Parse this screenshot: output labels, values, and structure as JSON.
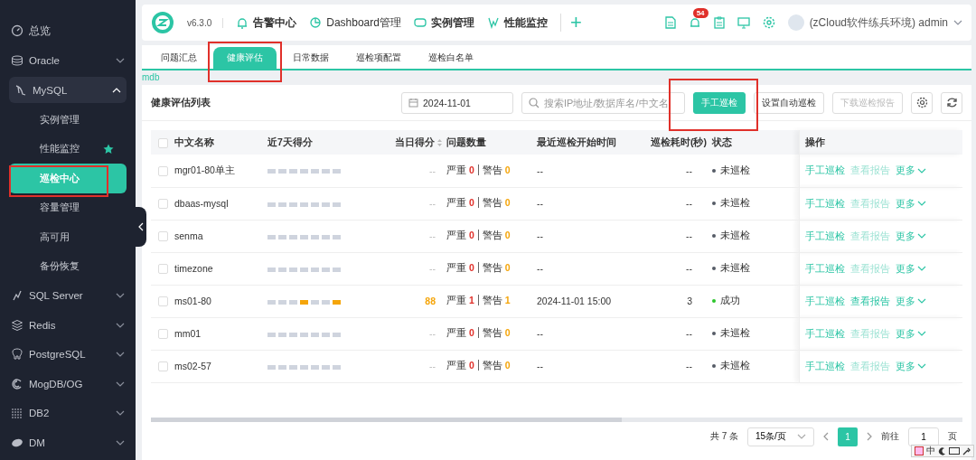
{
  "sidebar": {
    "items": [
      {
        "label": "总览"
      },
      {
        "label": "Oracle",
        "expanded": false
      },
      {
        "label": "MySQL",
        "expanded": true,
        "children": [
          {
            "label": "实例管理",
            "selected": false,
            "starred": false,
            "highlighted": false
          },
          {
            "label": "性能监控",
            "selected": false,
            "starred": true,
            "highlighted": false
          },
          {
            "label": "巡检中心",
            "selected": true,
            "starred": false,
            "highlighted": true
          },
          {
            "label": "容量管理",
            "selected": false,
            "starred": false,
            "highlighted": false
          },
          {
            "label": "高可用",
            "selected": false,
            "starred": false,
            "highlighted": false
          },
          {
            "label": "备份恢复",
            "selected": false,
            "starred": false,
            "highlighted": false
          }
        ]
      },
      {
        "label": "SQL Server",
        "expanded": false
      },
      {
        "label": "Redis",
        "expanded": false
      },
      {
        "label": "PostgreSQL",
        "expanded": false
      },
      {
        "label": "MogDB/OG",
        "expanded": false
      },
      {
        "label": "DB2",
        "expanded": false
      },
      {
        "label": "DM",
        "expanded": false
      }
    ]
  },
  "header": {
    "version": "v6.3.0",
    "nav": [
      "告警中心",
      "Dashboard管理",
      "实例管理",
      "性能监控"
    ],
    "add": "+",
    "alert_count": "54",
    "user": "(zCloud软件练兵环境) admin"
  },
  "tabs": [
    {
      "label": "问题汇总",
      "selected": false,
      "highlighted": false
    },
    {
      "label": "健康评估",
      "selected": true,
      "highlighted": true
    },
    {
      "label": "日常数据",
      "selected": false,
      "highlighted": false
    },
    {
      "label": "巡检项配置",
      "selected": false,
      "highlighted": false
    },
    {
      "label": "巡检白名单",
      "selected": false,
      "highlighted": false
    }
  ],
  "breadcrumb": "mdb",
  "panel": {
    "title": "健康评估列表",
    "date": "2024-11-01",
    "search": {
      "placeholder": "搜索IP地址/数据库名/中文名"
    },
    "buttons": [
      {
        "label": "手工巡检",
        "kind": "primary",
        "disabled": false,
        "highlighted": true
      },
      {
        "label": "设置自动巡检",
        "kind": "default",
        "disabled": false,
        "highlighted": false
      },
      {
        "label": "下载巡检报告",
        "kind": "default",
        "disabled": true,
        "highlighted": false
      }
    ]
  },
  "table": {
    "all_checked": false,
    "columns": [
      "中文名称",
      "近7天得分",
      "当日得分",
      "问题数量",
      "最近巡检开始时间",
      "巡检耗时(秒)",
      "状态",
      "操作"
    ],
    "rows": [
      {
        "checked": false,
        "name": "mgr01-80单主",
        "week_warn": [
          false,
          false,
          false,
          false,
          false,
          false,
          false
        ],
        "score": "--",
        "severe_label": "严重",
        "severe": "0",
        "warn_label": "警告",
        "warn": "0",
        "start": "--",
        "duration": "--",
        "status": "未巡检",
        "color": "#555b66",
        "actions": [
          "手工巡检",
          "查看报告",
          "更多"
        ],
        "report_enabled": false
      },
      {
        "checked": false,
        "name": "dbaas-mysql",
        "week_warn": [
          false,
          false,
          false,
          false,
          false,
          false,
          false
        ],
        "score": "--",
        "severe_label": "严重",
        "severe": "0",
        "warn_label": "警告",
        "warn": "0",
        "start": "--",
        "duration": "--",
        "status": "未巡检",
        "color": "#555b66",
        "actions": [
          "手工巡检",
          "查看报告",
          "更多"
        ],
        "report_enabled": false
      },
      {
        "checked": false,
        "name": "senma",
        "week_warn": [
          false,
          false,
          false,
          false,
          false,
          false,
          false
        ],
        "score": "--",
        "severe_label": "严重",
        "severe": "0",
        "warn_label": "警告",
        "warn": "0",
        "start": "--",
        "duration": "--",
        "status": "未巡检",
        "color": "#555b66",
        "actions": [
          "手工巡检",
          "查看报告",
          "更多"
        ],
        "report_enabled": false
      },
      {
        "checked": false,
        "name": "timezone",
        "week_warn": [
          false,
          false,
          false,
          false,
          false,
          false,
          false
        ],
        "score": "--",
        "severe_label": "严重",
        "severe": "0",
        "warn_label": "警告",
        "warn": "0",
        "start": "--",
        "duration": "--",
        "status": "未巡检",
        "color": "#555b66",
        "actions": [
          "手工巡检",
          "查看报告",
          "更多"
        ],
        "report_enabled": false
      },
      {
        "checked": false,
        "name": "ms01-80",
        "week_warn": [
          false,
          false,
          false,
          true,
          false,
          false,
          true
        ],
        "score": "88",
        "severe_label": "严重",
        "severe": "1",
        "warn_label": "警告",
        "warn": "1",
        "start": "2024-11-01 15:00",
        "duration": "3",
        "status": "成功",
        "color": "#2bc52b",
        "actions": [
          "手工巡检",
          "查看报告",
          "更多"
        ],
        "report_enabled": true
      },
      {
        "checked": false,
        "name": "mm01",
        "week_warn": [
          false,
          false,
          false,
          false,
          false,
          false,
          false
        ],
        "score": "--",
        "severe_label": "严重",
        "severe": "0",
        "warn_label": "警告",
        "warn": "0",
        "start": "--",
        "duration": "--",
        "status": "未巡检",
        "color": "#555b66",
        "actions": [
          "手工巡检",
          "查看报告",
          "更多"
        ],
        "report_enabled": false
      },
      {
        "checked": false,
        "name": "ms02-57",
        "week_warn": [
          false,
          false,
          false,
          false,
          false,
          false,
          false
        ],
        "score": "--",
        "severe_label": "严重",
        "severe": "0",
        "warn_label": "警告",
        "warn": "0",
        "start": "--",
        "duration": "--",
        "status": "未巡检",
        "color": "#555b66",
        "actions": [
          "手工巡检",
          "查看报告",
          "更多"
        ],
        "report_enabled": false
      }
    ]
  },
  "pager": {
    "total": "共 7 条",
    "page_size": "15条/页",
    "pages": [
      {
        "label": "1",
        "selected": true
      }
    ],
    "goto_label": "前往",
    "goto_value": "1",
    "goto_suffix": "页"
  },
  "ime_toolbar": {
    "mode": "中"
  }
}
